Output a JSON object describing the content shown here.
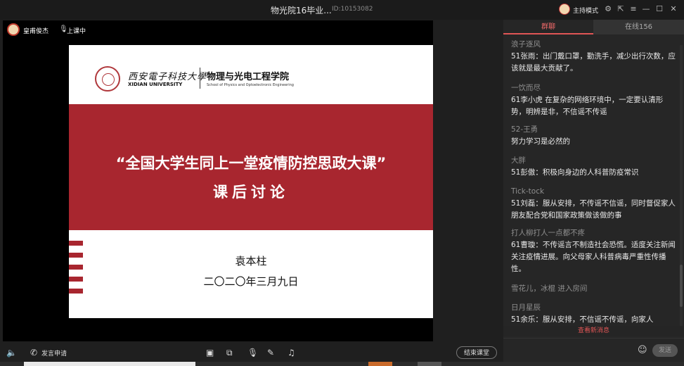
{
  "window": {
    "title": "物光院16毕业...",
    "id_label": "ID:10153082",
    "mode": "主持模式"
  },
  "host": {
    "name": "皇甫俊杰",
    "status": "上课中"
  },
  "slide": {
    "university_cn": "西安電子科技大學",
    "university_en": "XIDIAN UNIVERSITY",
    "school_cn": "物理与光电工程学院",
    "school_en": "School of Physics and Optoelectronic Engineering",
    "title_line1": "“全国大学生同上一堂疫情防控思政大课”",
    "title_line2": "课后讨论",
    "author": "袁本柱",
    "date": "二〇二〇年三月九日"
  },
  "toolbar": {
    "speak_request": "发言申请",
    "end_class": "结束课堂"
  },
  "chat": {
    "tab_chat": "群聊",
    "tab_online": "在线156",
    "messages": [
      {
        "name": "浪子逐风",
        "text": "51张雨：出门戴口罩，勤洗手，减少出行次数，应该就是最大贡献了。"
      },
      {
        "name": "一饮而尽",
        "text": "61李小虎 在复杂的网络环境中，一定要认清形势，明辨是非，不信谣不传谣"
      },
      {
        "name": "52-王勇",
        "text": "努力学习是必然的"
      },
      {
        "name": "大胖",
        "text": "51彭傲：积极向身边的人科普防疫常识"
      },
      {
        "name": "Tick-tock",
        "text": "51刘磊：服从安排，不传谣不信谣，同时督促家人朋友配合党和国家政策做该做的事"
      },
      {
        "name": "打人柳打人一点都不疼",
        "text": "61曹璇：不传谣言不制造社会恐慌。适度关注新闻关注疫情进展。向父母家人科普病毒严重性传播性。"
      },
      {
        "name": "日月星辰",
        "text": "51余乐：服从安排，不信谣不传谣，向家人"
      }
    ],
    "system_message": "雪花儿，冰棍 进入房间",
    "new_messages": "查看新消息",
    "send": "发送"
  }
}
